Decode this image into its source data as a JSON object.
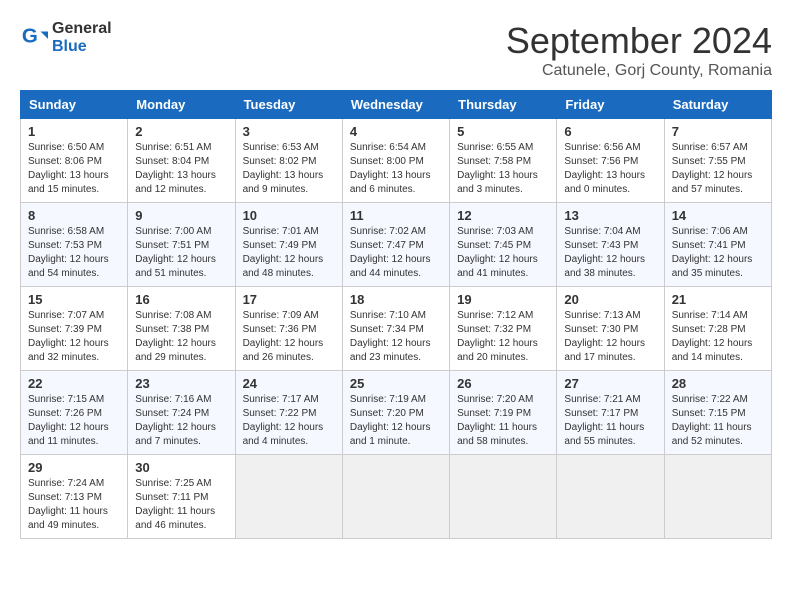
{
  "header": {
    "logo_general": "General",
    "logo_blue": "Blue",
    "month_title": "September 2024",
    "location": "Catunele, Gorj County, Romania"
  },
  "days_of_week": [
    "Sunday",
    "Monday",
    "Tuesday",
    "Wednesday",
    "Thursday",
    "Friday",
    "Saturday"
  ],
  "weeks": [
    [
      {
        "day": "1",
        "sunrise": "6:50 AM",
        "sunset": "8:06 PM",
        "daylight": "13 hours and 15 minutes."
      },
      {
        "day": "2",
        "sunrise": "6:51 AM",
        "sunset": "8:04 PM",
        "daylight": "13 hours and 12 minutes."
      },
      {
        "day": "3",
        "sunrise": "6:53 AM",
        "sunset": "8:02 PM",
        "daylight": "13 hours and 9 minutes."
      },
      {
        "day": "4",
        "sunrise": "6:54 AM",
        "sunset": "8:00 PM",
        "daylight": "13 hours and 6 minutes."
      },
      {
        "day": "5",
        "sunrise": "6:55 AM",
        "sunset": "7:58 PM",
        "daylight": "13 hours and 3 minutes."
      },
      {
        "day": "6",
        "sunrise": "6:56 AM",
        "sunset": "7:56 PM",
        "daylight": "13 hours and 0 minutes."
      },
      {
        "day": "7",
        "sunrise": "6:57 AM",
        "sunset": "7:55 PM",
        "daylight": "12 hours and 57 minutes."
      }
    ],
    [
      {
        "day": "8",
        "sunrise": "6:58 AM",
        "sunset": "7:53 PM",
        "daylight": "12 hours and 54 minutes."
      },
      {
        "day": "9",
        "sunrise": "7:00 AM",
        "sunset": "7:51 PM",
        "daylight": "12 hours and 51 minutes."
      },
      {
        "day": "10",
        "sunrise": "7:01 AM",
        "sunset": "7:49 PM",
        "daylight": "12 hours and 48 minutes."
      },
      {
        "day": "11",
        "sunrise": "7:02 AM",
        "sunset": "7:47 PM",
        "daylight": "12 hours and 44 minutes."
      },
      {
        "day": "12",
        "sunrise": "7:03 AM",
        "sunset": "7:45 PM",
        "daylight": "12 hours and 41 minutes."
      },
      {
        "day": "13",
        "sunrise": "7:04 AM",
        "sunset": "7:43 PM",
        "daylight": "12 hours and 38 minutes."
      },
      {
        "day": "14",
        "sunrise": "7:06 AM",
        "sunset": "7:41 PM",
        "daylight": "12 hours and 35 minutes."
      }
    ],
    [
      {
        "day": "15",
        "sunrise": "7:07 AM",
        "sunset": "7:39 PM",
        "daylight": "12 hours and 32 minutes."
      },
      {
        "day": "16",
        "sunrise": "7:08 AM",
        "sunset": "7:38 PM",
        "daylight": "12 hours and 29 minutes."
      },
      {
        "day": "17",
        "sunrise": "7:09 AM",
        "sunset": "7:36 PM",
        "daylight": "12 hours and 26 minutes."
      },
      {
        "day": "18",
        "sunrise": "7:10 AM",
        "sunset": "7:34 PM",
        "daylight": "12 hours and 23 minutes."
      },
      {
        "day": "19",
        "sunrise": "7:12 AM",
        "sunset": "7:32 PM",
        "daylight": "12 hours and 20 minutes."
      },
      {
        "day": "20",
        "sunrise": "7:13 AM",
        "sunset": "7:30 PM",
        "daylight": "12 hours and 17 minutes."
      },
      {
        "day": "21",
        "sunrise": "7:14 AM",
        "sunset": "7:28 PM",
        "daylight": "12 hours and 14 minutes."
      }
    ],
    [
      {
        "day": "22",
        "sunrise": "7:15 AM",
        "sunset": "7:26 PM",
        "daylight": "12 hours and 11 minutes."
      },
      {
        "day": "23",
        "sunrise": "7:16 AM",
        "sunset": "7:24 PM",
        "daylight": "12 hours and 7 minutes."
      },
      {
        "day": "24",
        "sunrise": "7:17 AM",
        "sunset": "7:22 PM",
        "daylight": "12 hours and 4 minutes."
      },
      {
        "day": "25",
        "sunrise": "7:19 AM",
        "sunset": "7:20 PM",
        "daylight": "12 hours and 1 minute."
      },
      {
        "day": "26",
        "sunrise": "7:20 AM",
        "sunset": "7:19 PM",
        "daylight": "11 hours and 58 minutes."
      },
      {
        "day": "27",
        "sunrise": "7:21 AM",
        "sunset": "7:17 PM",
        "daylight": "11 hours and 55 minutes."
      },
      {
        "day": "28",
        "sunrise": "7:22 AM",
        "sunset": "7:15 PM",
        "daylight": "11 hours and 52 minutes."
      }
    ],
    [
      {
        "day": "29",
        "sunrise": "7:24 AM",
        "sunset": "7:13 PM",
        "daylight": "11 hours and 49 minutes."
      },
      {
        "day": "30",
        "sunrise": "7:25 AM",
        "sunset": "7:11 PM",
        "daylight": "11 hours and 46 minutes."
      },
      null,
      null,
      null,
      null,
      null
    ]
  ]
}
